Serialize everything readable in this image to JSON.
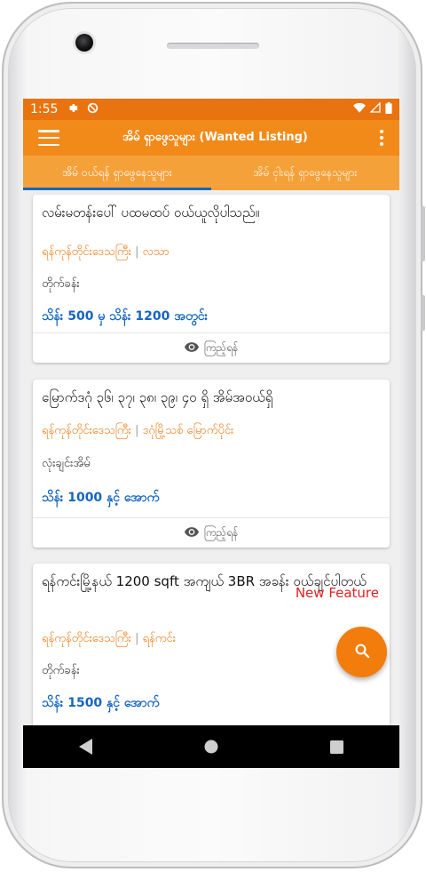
{
  "status_bar": {
    "time": "1:55"
  },
  "app_bar": {
    "title": "အိမ် ရှာဖွေသူများ (Wanted Listing)"
  },
  "tabs": [
    {
      "label": "အိမ် ဝယ်ရန် ရှာဖွေနေသူများ",
      "active": true
    },
    {
      "label": "အိမ် ငှါးရန် ရှာဖွေနေသူများ",
      "active": false
    }
  ],
  "listings": [
    {
      "title": "လမ်းမတန်းပေါ် ပထမထပ် ဝယ်ယူလိုပါသည်။",
      "region": "ရန်ကုန်တိုင်းဒေသကြီး",
      "township": "လသာ",
      "property_type": "တိုက်ခန်း",
      "price": "သိန်း 500 မှ သိန်း 1200 အတွင်း",
      "view_label": "ကြည့်ရန်"
    },
    {
      "title": "မြောက်ဒဂုံ ၃၆၊ ၃၇၊ ၃၈၊ ၃၉၊ ၄၀ ရှိ အိမ်အဝယ်ရှိ",
      "region": "ရန်ကုန်တိုင်းဒေသကြီး",
      "township": "ဒဂုံမြို့သစ် မြောက်ပိုင်း",
      "property_type": "လုံးချင်းအိမ်",
      "price": "သိန်း 1000 နှင့် အောက်",
      "view_label": "ကြည့်ရန်"
    },
    {
      "title": "ရန်ကင်းမြို့နယ် 1200 sqft အကျယ် 3BR အခန်း ဝယ်ချင်ပါတယ်",
      "region": "ရန်ကုန်တိုင်းဒေသကြီး",
      "township": "ရန်ကင်း",
      "property_type": "တိုက်ခန်း",
      "price": "သိန်း 1500 နှင့် အောက်"
    }
  ],
  "separator": "|",
  "new_feature_label": "New Feature",
  "fab_icon": "search-icon",
  "colors": {
    "status_bar": "#e8730f",
    "app_bar": "#f28a1a",
    "tabs_bg": "#f5a13a",
    "tab_indicator": "#1565c0",
    "location_text": "#ef7d19",
    "price_text": "#1565c0",
    "new_feature": "#e02020",
    "fab": "#f27d0c"
  }
}
